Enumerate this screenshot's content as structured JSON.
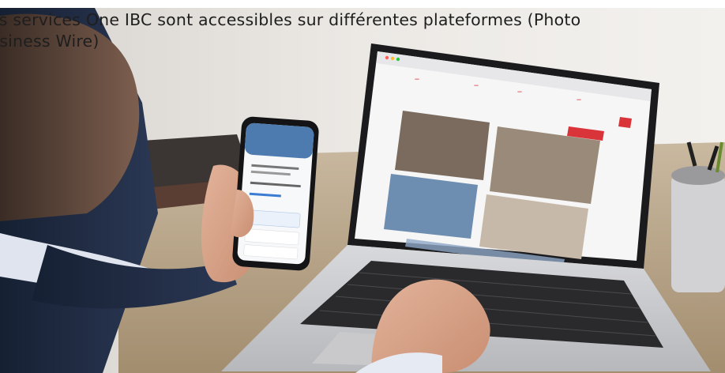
{
  "caption": {
    "line1": "es services One IBC sont accessibles sur différentes plateformes (Photo",
    "line2": "usiness Wire)"
  },
  "photo": {
    "description_icons": [
      "laptop-icon",
      "smartphone-icon"
    ],
    "colors": {
      "accent_red": "#d9343a",
      "suit": "#1f2a44",
      "desk": "#b9a98f"
    }
  }
}
